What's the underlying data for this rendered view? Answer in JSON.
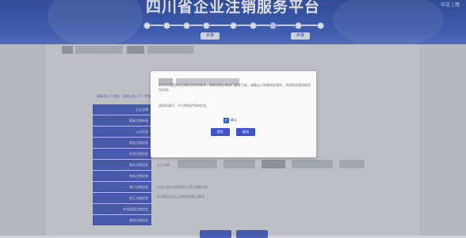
{
  "header": {
    "site_title": "四川省企业注销服务平台",
    "lang_switch": "中文 | 简",
    "steps": [
      "步骤",
      "步骤"
    ]
  },
  "page": {
    "intro_link": "请阅读以下内容，勾选后进入下一步操作",
    "side_menu": [
      "企业注销",
      "简易注销申请",
      "公告信息",
      "税务注销信息",
      "社保注销信息",
      "海关注销信息",
      "商务注销信息",
      "银行注销信息",
      "外汇注销信息",
      "市场监管注销信息",
      "其他注销信息"
    ],
    "form_lines": [
      "企业名称",
      "企业已经与全体投资人签订清算协议",
      "企业登记机关已核准注销登记事项"
    ]
  },
  "modal": {
    "paragraph": "本平台所提供的注销信息仅供参考，具体办理以各部门要求为准，请确认已知晓相关事项，并按照办理流程逐项办理。",
    "note": "请如实填写，平台将保护您的信息。",
    "confirm_label": "确认",
    "buttons": {
      "ok": "提交",
      "cancel": "取消"
    }
  },
  "colors": {
    "header": "#3f62c4",
    "menu": "#4a5ec0",
    "primary_button": "#3d55c9",
    "checkbox": "#3b6fe0"
  }
}
